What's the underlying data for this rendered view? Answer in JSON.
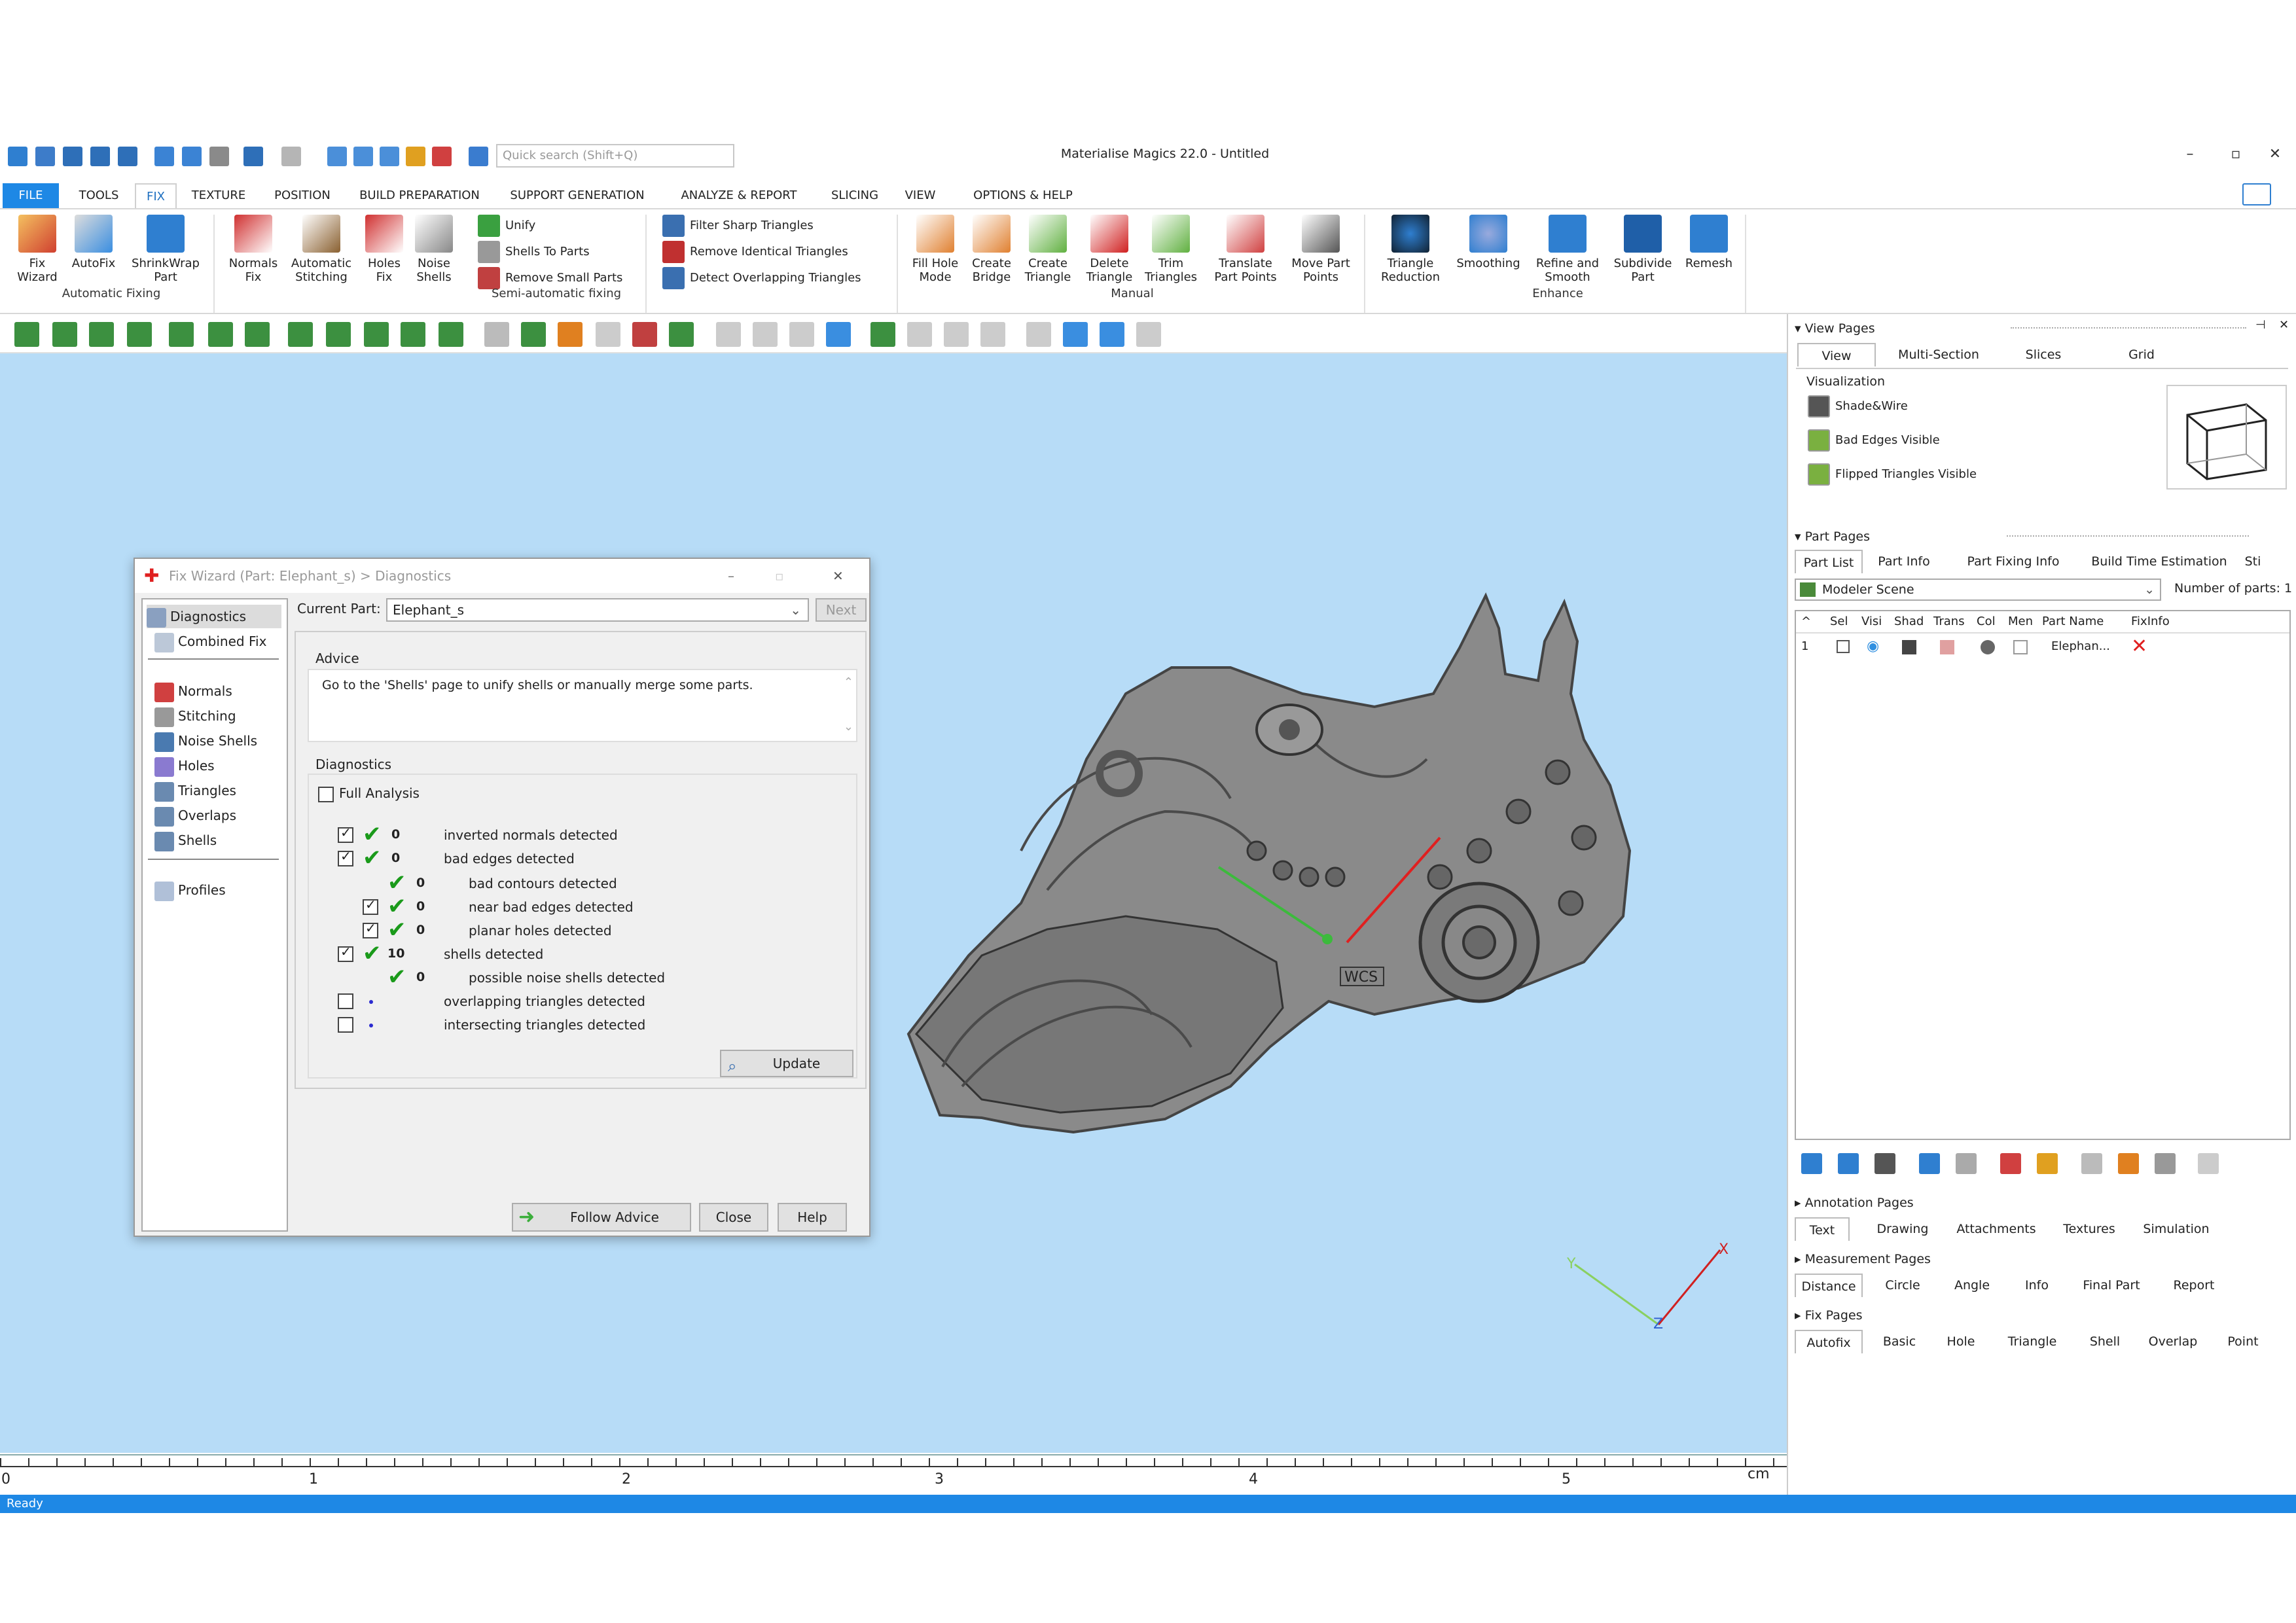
{
  "window": {
    "title": "Materialise Magics 22.0 - Untitled",
    "search_placeholder": "Quick search (Shift+Q)",
    "minimize": "–",
    "maximize": "▫",
    "close": "✕"
  },
  "menu": {
    "tabs": [
      "FILE",
      "TOOLS",
      "FIX",
      "TEXTURE",
      "POSITION",
      "BUILD PREPARATION",
      "SUPPORT GENERATION",
      "ANALYZE & REPORT",
      "SLICING",
      "VIEW",
      "OPTIONS & HELP"
    ],
    "active": "FIX"
  },
  "ribbon": {
    "automatic": {
      "label": "Automatic Fixing",
      "buttons": [
        {
          "l1": "Fix",
          "l2": "Wizard"
        },
        {
          "l1": "AutoFix",
          "l2": ""
        },
        {
          "l1": "ShrinkWrap",
          "l2": "Part"
        }
      ]
    },
    "semi": {
      "label": "Semi-automatic fixing",
      "buttons": [
        {
          "l1": "Normals",
          "l2": "Fix"
        },
        {
          "l1": "Automatic",
          "l2": "Stitching"
        },
        {
          "l1": "Holes",
          "l2": "Fix"
        },
        {
          "l1": "Noise",
          "l2": "Shells"
        }
      ],
      "small": [
        "Unify",
        "Shells To Parts",
        "Remove Small Parts"
      ],
      "small2": [
        "Filter Sharp Triangles",
        "Remove Identical Triangles",
        "Detect Overlapping Triangles"
      ]
    },
    "manual": {
      "label": "Manual",
      "buttons": [
        {
          "l1": "Fill Hole",
          "l2": "Mode"
        },
        {
          "l1": "Create",
          "l2": "Bridge"
        },
        {
          "l1": "Create",
          "l2": "Triangle"
        },
        {
          "l1": "Delete",
          "l2": "Triangle"
        },
        {
          "l1": "Trim",
          "l2": "Triangles"
        },
        {
          "l1": "Translate",
          "l2": "Part Points"
        },
        {
          "l1": "Move Part",
          "l2": "Points"
        }
      ]
    },
    "enhance": {
      "label": "Enhance",
      "buttons": [
        {
          "l1": "Triangle",
          "l2": "Reduction"
        },
        {
          "l1": "Smoothing",
          "l2": ""
        },
        {
          "l1": "Refine and",
          "l2": "Smooth"
        },
        {
          "l1": "Subdivide",
          "l2": "Part"
        },
        {
          "l1": "Remesh",
          "l2": ""
        }
      ]
    }
  },
  "dialog": {
    "title": "Fix Wizard (Part: Elephant_s) > Diagnostics",
    "nav_top": [
      "Diagnostics",
      "Combined Fix"
    ],
    "nav_mid": [
      "Normals",
      "Stitching",
      "Noise Shells",
      "Holes",
      "Triangles",
      "Overlaps",
      "Shells"
    ],
    "nav_bottom": [
      "Profiles"
    ],
    "current_part_label": "Current Part:",
    "current_part": "Elephant_s",
    "next": "Next",
    "advice_label": "Advice",
    "advice_text": "Go to the 'Shells' page to unify shells or manually merge some parts.",
    "diagnostics_label": "Diagnostics",
    "full_analysis": "Full Analysis",
    "rows": [
      {
        "count": "0",
        "text": "inverted normals detected"
      },
      {
        "count": "0",
        "text": "bad edges detected"
      },
      {
        "count": "0",
        "text": "bad contours detected"
      },
      {
        "count": "0",
        "text": "near bad edges detected"
      },
      {
        "count": "0",
        "text": "planar holes detected"
      },
      {
        "count": "10",
        "text": "shells detected"
      },
      {
        "count": "0",
        "text": "possible noise shells detected"
      },
      {
        "count": "",
        "text": "overlapping triangles detected"
      },
      {
        "count": "",
        "text": "intersecting triangles detected"
      }
    ],
    "update": "Update",
    "follow_advice": "Follow Advice",
    "close": "Close",
    "help": "Help"
  },
  "viewport": {
    "wcs": "WCS",
    "axis_x": "X",
    "axis_y": "Y",
    "axis_z": "Z"
  },
  "ruler": {
    "ticks": [
      "0",
      "1",
      "2",
      "3",
      "4",
      "5"
    ],
    "unit": "cm"
  },
  "status": "Ready",
  "right_panel": {
    "view_pages": {
      "title": "View Pages",
      "tabs": [
        "View",
        "Multi-Section",
        "Slices",
        "Grid"
      ],
      "visualization": "Visualization",
      "options": [
        "Shade&Wire",
        "Bad Edges Visible",
        "Flipped Triangles Visible"
      ]
    },
    "part_pages": {
      "title": "Part Pages",
      "tabs": [
        "Part List",
        "Part Info",
        "Part Fixing Info",
        "Build Time Estimation",
        "Sti"
      ],
      "scene": "Modeler Scene",
      "num_parts_label": "Number of parts:",
      "num_parts": "1",
      "columns": [
        "Sel",
        "Visi",
        "Shad",
        "Trans",
        "Col",
        "Men",
        "Part Name",
        "FixInfo"
      ],
      "rows": [
        {
          "idx": "1",
          "name": "Elephan..."
        }
      ]
    },
    "annotation_pages": {
      "title": "Annotation Pages",
      "tabs": [
        "Text",
        "Drawing",
        "Attachments",
        "Textures",
        "Simulation"
      ]
    },
    "measurement_pages": {
      "title": "Measurement Pages",
      "tabs": [
        "Distance",
        "Circle",
        "Angle",
        "Info",
        "Final Part",
        "Report"
      ]
    },
    "fix_pages": {
      "title": "Fix Pages",
      "tabs": [
        "Autofix",
        "Basic",
        "Hole",
        "Triangle",
        "Shell",
        "Overlap",
        "Point"
      ]
    }
  }
}
